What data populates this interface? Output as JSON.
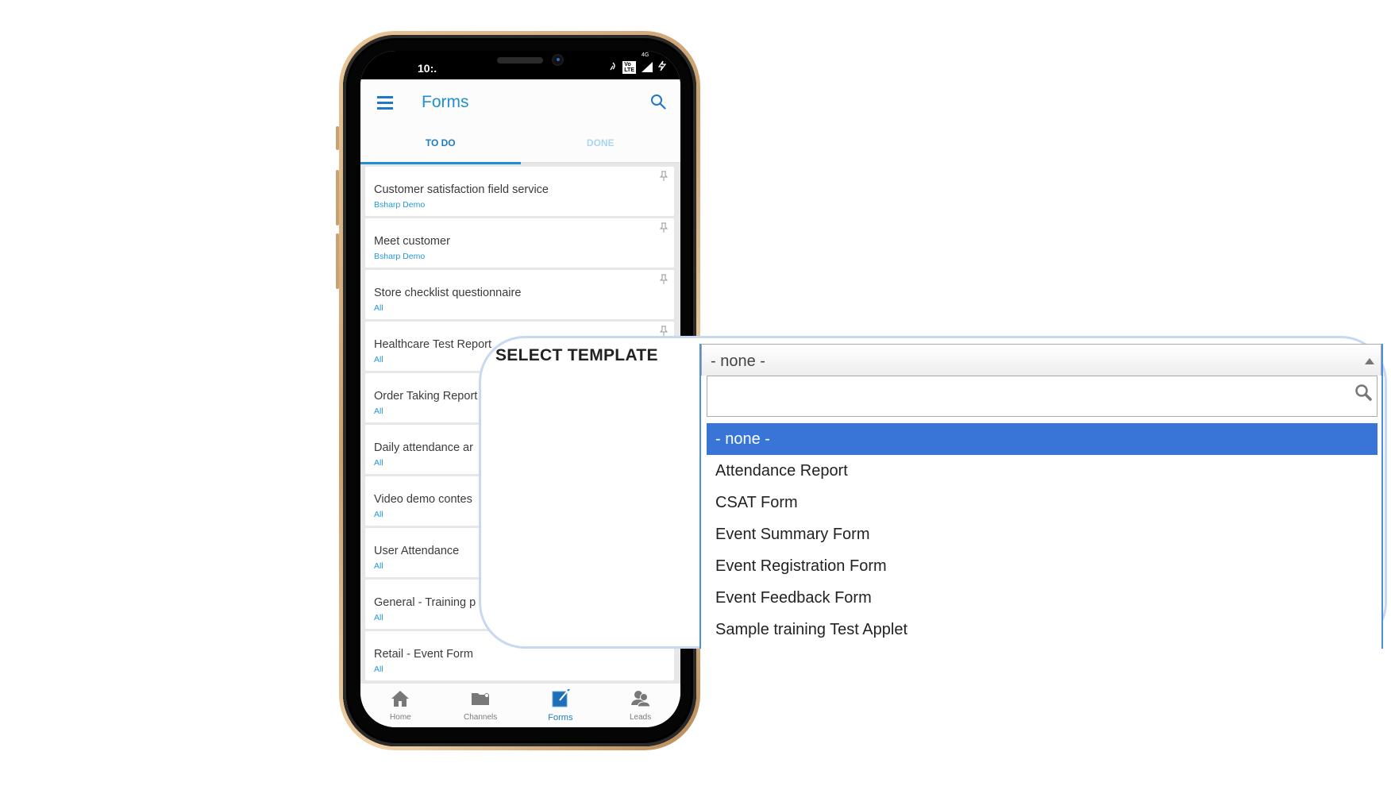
{
  "status_bar": {
    "time": "10:."
  },
  "app_bar": {
    "title": "Forms"
  },
  "tabs": [
    {
      "label": "TO DO",
      "active": true
    },
    {
      "label": "DONE",
      "active": false
    }
  ],
  "forms": [
    {
      "title": "Customer satisfaction field service",
      "subtitle": "Bsharp Demo"
    },
    {
      "title": "Meet customer",
      "subtitle": "Bsharp Demo"
    },
    {
      "title": "Store checklist questionnaire",
      "subtitle": "All"
    },
    {
      "title": "Healthcare Test Report",
      "subtitle": "All"
    },
    {
      "title": "Order Taking Report",
      "subtitle": "All"
    },
    {
      "title": "Daily attendance ar",
      "subtitle": "All"
    },
    {
      "title": "Video demo contes",
      "subtitle": "All"
    },
    {
      "title": "User Attendance",
      "subtitle": "All"
    },
    {
      "title": "General - Training p",
      "subtitle": "All"
    },
    {
      "title": "Retail - Event Form",
      "subtitle": "All"
    }
  ],
  "bottom_nav": [
    {
      "label": "Home",
      "icon": "home-icon",
      "active": false
    },
    {
      "label": "Channels",
      "icon": "folder-icon",
      "active": false
    },
    {
      "label": "Forms",
      "icon": "edit-form-icon",
      "active": true
    },
    {
      "label": "Leads",
      "icon": "users-icon",
      "active": false
    }
  ],
  "select_template": {
    "label": "SELECT TEMPLATE",
    "selected": "- none -",
    "search_value": "",
    "options": [
      "- none -",
      "Attendance Report",
      "CSAT Form",
      "Event Summary Form",
      "Event Registration Form",
      "Event Feedback Form",
      "Sample training Test Applet"
    ]
  },
  "colors": {
    "accent": "#1f8fd0",
    "selected_option": "#3875d7",
    "subtitle": "#2499d6"
  }
}
